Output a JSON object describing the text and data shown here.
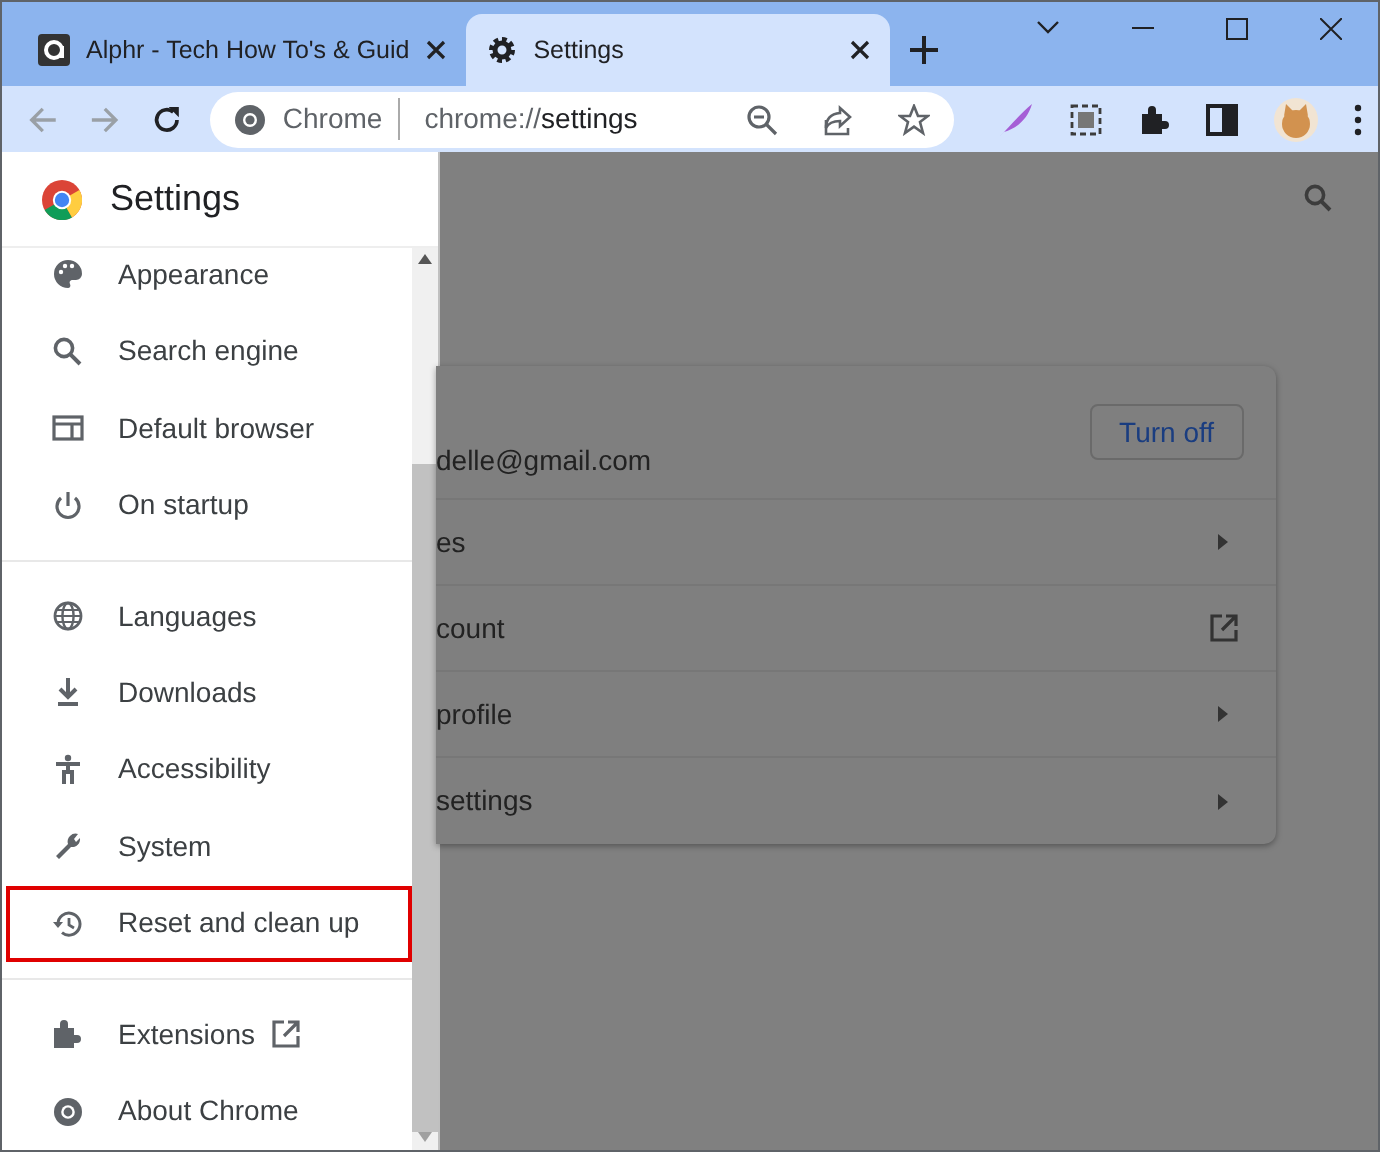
{
  "tabs": [
    {
      "title": "Alphr - Tech How To's & Guid",
      "selected": false
    },
    {
      "title": "Settings",
      "selected": true
    }
  ],
  "toolbar": {
    "chip": "Chrome",
    "url_scheme": "chrome://",
    "url_path": "settings"
  },
  "sidebar": {
    "title": "Settings",
    "items": [
      {
        "label": "Appearance",
        "highlighted": false,
        "kind": "page"
      },
      {
        "label": "Search engine",
        "highlighted": false,
        "kind": "page"
      },
      {
        "label": "Default browser",
        "highlighted": false,
        "kind": "page"
      },
      {
        "label": "On startup",
        "highlighted": false,
        "kind": "page"
      },
      {
        "label": "Languages",
        "highlighted": false,
        "kind": "page"
      },
      {
        "label": "Downloads",
        "highlighted": false,
        "kind": "page"
      },
      {
        "label": "Accessibility",
        "highlighted": false,
        "kind": "page"
      },
      {
        "label": "System",
        "highlighted": false,
        "kind": "page"
      },
      {
        "label": "Reset and clean up",
        "highlighted": true,
        "kind": "page"
      },
      {
        "label": "Extensions",
        "highlighted": false,
        "kind": "external"
      },
      {
        "label": "About Chrome",
        "highlighted": false,
        "kind": "page"
      }
    ]
  },
  "card": {
    "email": "delle@gmail.com",
    "button": "Turn off",
    "rows": [
      {
        "label": "es",
        "kind": "arrow"
      },
      {
        "label": "count",
        "kind": "external"
      },
      {
        "label": "profile",
        "kind": "arrow"
      },
      {
        "label": "settings",
        "kind": "arrow"
      }
    ]
  }
}
